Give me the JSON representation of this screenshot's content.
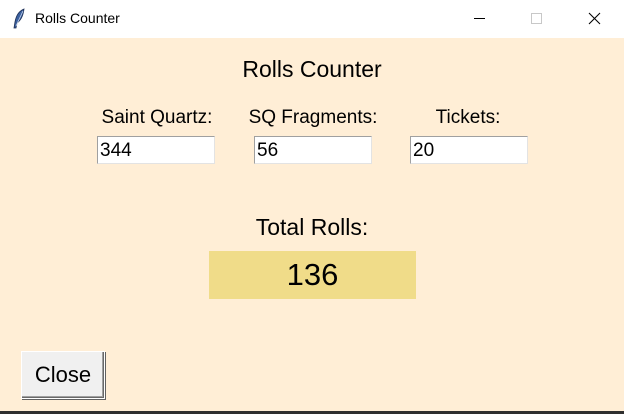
{
  "window": {
    "title": "Rolls Counter",
    "app_icon": "feather-icon",
    "controls": [
      "minimize-icon",
      "maximize-icon",
      "close-icon"
    ]
  },
  "heading": "Rolls Counter",
  "fields": {
    "saint_quartz": {
      "label": "Saint Quartz:",
      "value": "344"
    },
    "sq_fragments": {
      "label": "SQ Fragments:",
      "value": "56"
    },
    "tickets": {
      "label": "Tickets:",
      "value": "20"
    }
  },
  "total": {
    "label": "Total Rolls:",
    "value": "136"
  },
  "close_button": {
    "label": "Close"
  },
  "colors": {
    "background": "#ffeed6",
    "total_box": "#f0dc89",
    "button_face": "#f0f0f0"
  }
}
